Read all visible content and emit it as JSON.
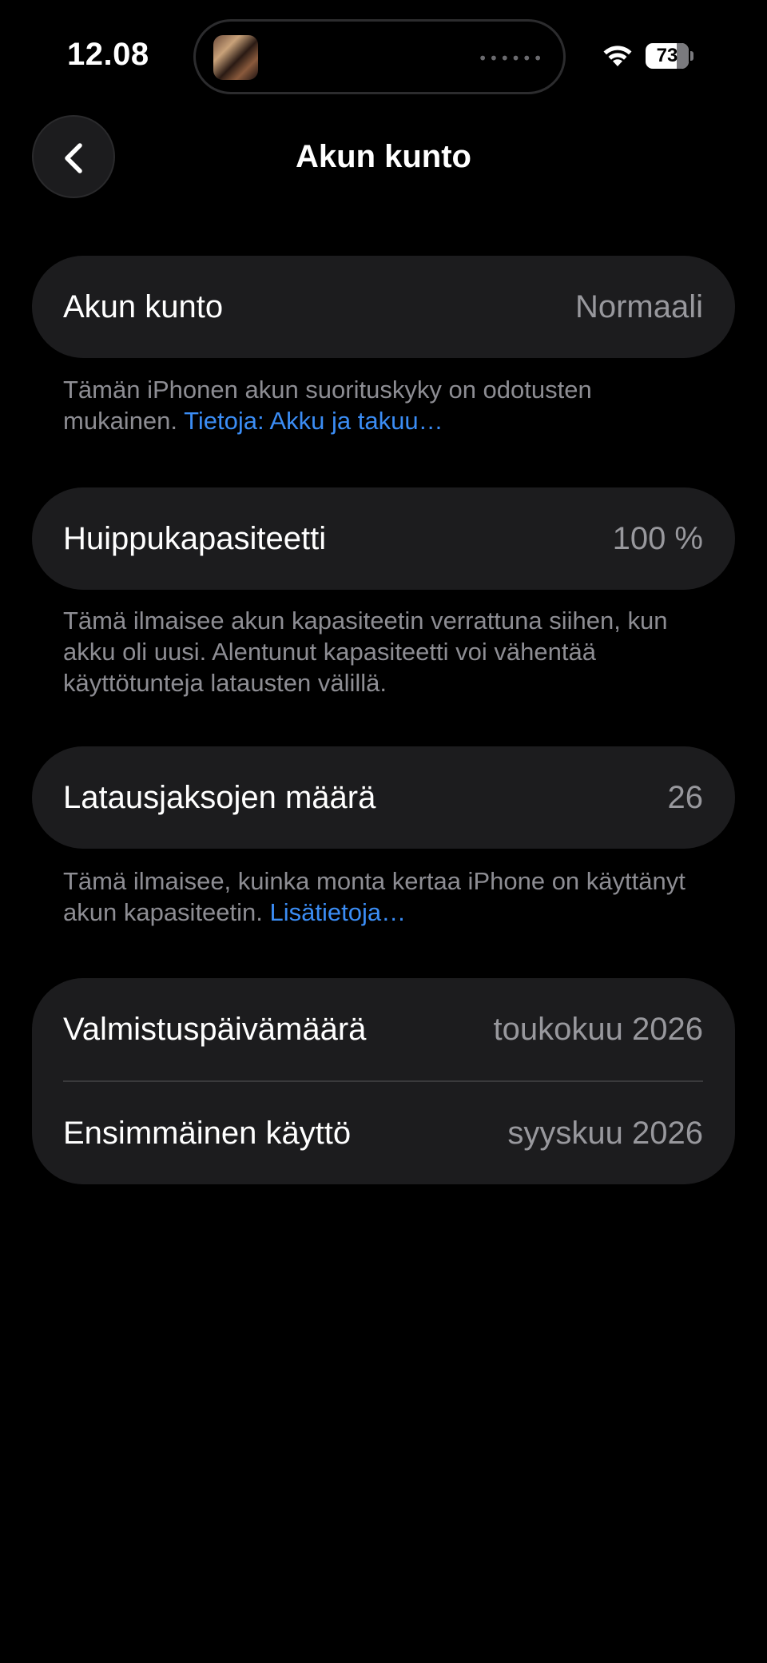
{
  "status_bar": {
    "time": "12.08",
    "battery_percent": "73",
    "battery_level": 0.73,
    "wifi_icon": "wifi-icon",
    "island_dots": "••••••"
  },
  "nav": {
    "back_icon": "chevron-left-icon",
    "title": "Akun kunto"
  },
  "sections": {
    "health": {
      "label": "Akun kunto",
      "value": "Normaali",
      "note_text": "Tämän iPhonen akun suorituskyky on odotusten mukainen.",
      "note_link": "Tietoja: Akku ja takuu…"
    },
    "peak": {
      "label": "Huippukapasiteetti",
      "value": "100 %",
      "note_text": "Tämä ilmaisee akun kapasiteetin verrattuna siihen, kun akku oli uusi. Alentunut kapasiteetti voi vähentää käyttötunteja latausten välillä."
    },
    "cycles": {
      "label": "Latausjaksojen määrä",
      "value": "26",
      "note_text": "Tämä ilmaisee, kuinka monta kertaa iPhone on käyttänyt akun kapasiteetin.",
      "note_link": "Lisätietoja…"
    },
    "dates": {
      "manufacture_label": "Valmistuspäivämäärä",
      "manufacture_value": "toukokuu 2026",
      "first_use_label": "Ensimmäinen käyttö",
      "first_use_value": "syyskuu 2026"
    }
  },
  "colors": {
    "background": "#000000",
    "card": "#1c1c1e",
    "secondary_text": "#98989d",
    "link": "#3b8df5"
  }
}
